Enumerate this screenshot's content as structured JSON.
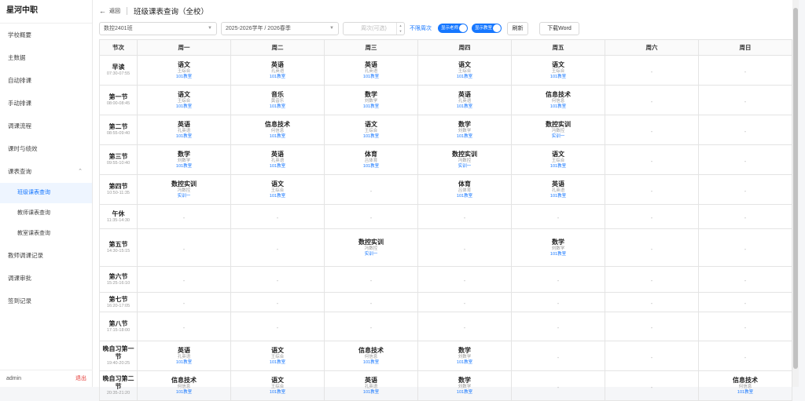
{
  "sidebar": {
    "brand": "星河中职",
    "items": [
      "学校概要",
      "主数据",
      "自动排课",
      "手动排课",
      "调课流程",
      "课时与绩效",
      "课表查询",
      "教师调课记录",
      "调课审批",
      "签到记录"
    ],
    "submenu": [
      "班级课表查询",
      "教师课表查询",
      "教室课表查询"
    ],
    "user": "admin",
    "logout": "退出"
  },
  "topbar": {
    "back": "返回",
    "title": "班级课表查询（全校）"
  },
  "filters": {
    "class": "数控2401班",
    "term": "2025-2026学年 / 2026春季",
    "week_placeholder": "周次(可选)",
    "all_weeks": "不限周次",
    "toggle1": "显示老师",
    "toggle2": "显示教室",
    "refresh": "刷新",
    "export": "下载Word"
  },
  "table": {
    "headers": [
      "节次",
      "周一",
      "周二",
      "周三",
      "周四",
      "周五",
      "周六",
      "周日"
    ],
    "rows": [
      {
        "name": "早读",
        "time": "07:30-07:55",
        "cells": [
          {
            "s": "语文",
            "t": "王综合",
            "r": "101教室"
          },
          {
            "s": "英语",
            "t": "孔英语",
            "r": "101教室"
          },
          {
            "s": "英语",
            "t": "孔英语",
            "r": "101教室"
          },
          {
            "s": "语文",
            "t": "王综合",
            "r": "101教室"
          },
          {
            "s": "语文",
            "t": "王综合",
            "r": "101教室"
          },
          null,
          null
        ]
      },
      {
        "name": "第一节",
        "time": "08:00-08:45",
        "cells": [
          {
            "s": "语文",
            "t": "王综合",
            "r": "101教室"
          },
          {
            "s": "音乐",
            "t": "黄音乐",
            "r": "101教室"
          },
          {
            "s": "数学",
            "t": "刘数学",
            "r": "101教室"
          },
          {
            "s": "英语",
            "t": "孔英语",
            "r": "101教室"
          },
          {
            "s": "信息技术",
            "t": "何信息",
            "r": "101教室"
          },
          null,
          null
        ]
      },
      {
        "name": "第二节",
        "time": "08:55-09:40",
        "cells": [
          {
            "s": "英语",
            "t": "孔英语",
            "r": "101教室"
          },
          {
            "s": "信息技术",
            "t": "何信息",
            "r": "101教室"
          },
          {
            "s": "语文",
            "t": "王综合",
            "r": "101教室"
          },
          {
            "s": "数学",
            "t": "刘数学",
            "r": "101教室"
          },
          {
            "s": "数控实训",
            "t": "冯数控",
            "r": "实训一"
          },
          null,
          null
        ]
      },
      {
        "name": "第三节",
        "time": "09:55-10:40",
        "cells": [
          {
            "s": "数学",
            "t": "刘数学",
            "r": "101教室"
          },
          {
            "s": "英语",
            "t": "孔英语",
            "r": "101教室"
          },
          {
            "s": "体育",
            "t": "吕体育",
            "r": "101教室"
          },
          {
            "s": "数控实训",
            "t": "冯数控",
            "r": "实训一"
          },
          {
            "s": "语文",
            "t": "王综合",
            "r": "101教室"
          },
          null,
          null
        ]
      },
      {
        "name": "第四节",
        "time": "10:50-11:35",
        "cells": [
          {
            "s": "数控实训",
            "t": "冯数控",
            "r": "实训一"
          },
          {
            "s": "语文",
            "t": "王综合",
            "r": "101教室"
          },
          null,
          {
            "s": "体育",
            "t": "吕体育",
            "r": "101教室"
          },
          {
            "s": "英语",
            "t": "孔英语",
            "r": "101教室"
          },
          null,
          null
        ]
      },
      {
        "name": "午休",
        "time": "11:35-14:30",
        "cells": [
          null,
          null,
          null,
          null,
          null,
          null,
          null
        ]
      },
      {
        "name": "第五节",
        "time": "14:30-15:15",
        "cells": [
          null,
          null,
          {
            "s": "数控实训",
            "t": "冯数控",
            "r": "实训一"
          },
          null,
          {
            "s": "数学",
            "t": "刘数学",
            "r": "101教室"
          },
          null,
          null
        ]
      },
      {
        "name": "第六节",
        "time": "15:25-16:10",
        "cells": [
          null,
          null,
          null,
          null,
          null,
          null,
          null
        ]
      },
      {
        "name": "第七节",
        "time": "16:20-17:05",
        "cells": [
          null,
          null,
          null,
          null,
          null,
          null,
          null
        ]
      },
      {
        "name": "第八节",
        "time": "17:15-18:00",
        "cells": [
          null,
          null,
          null,
          null,
          null,
          null,
          null
        ]
      },
      {
        "name": "晚自习第一节",
        "time": "19:40-20:25",
        "cells": [
          {
            "s": "英语",
            "t": "孔英语",
            "r": "101教室"
          },
          {
            "s": "语文",
            "t": "王综合",
            "r": "101教室"
          },
          {
            "s": "信息技术",
            "t": "何信息",
            "r": "101教室"
          },
          {
            "s": "数学",
            "t": "刘数学",
            "r": "101教室"
          },
          null,
          null,
          null
        ]
      },
      {
        "name": "晚自习第二节",
        "time": "20:35-21:20",
        "cells": [
          {
            "s": "信息技术",
            "t": "何信息",
            "r": "101教室"
          },
          {
            "s": "语文",
            "t": "王综合",
            "r": "101教室"
          },
          {
            "s": "英语",
            "t": "孔英语",
            "r": "101教室"
          },
          {
            "s": "数学",
            "t": "刘数学",
            "r": "101教室"
          },
          null,
          null,
          {
            "s": "信息技术",
            "t": "何信息",
            "r": "101教室"
          }
        ]
      }
    ],
    "empty": "-"
  }
}
